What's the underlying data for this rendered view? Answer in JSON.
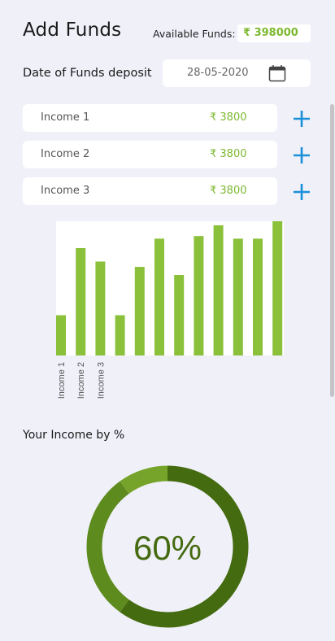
{
  "header": {
    "title": "Add Funds",
    "available_label": "Available Funds:",
    "available_value": "₹ 398000"
  },
  "deposit": {
    "label": "Date of Funds deposit",
    "date_value": "28-05-2020",
    "calendar_icon": "calendar-icon"
  },
  "incomes": [
    {
      "name": "Income 1",
      "amount": "₹ 3800"
    },
    {
      "name": "Income 2",
      "amount": "₹ 3800"
    },
    {
      "name": "Income 3",
      "amount": "₹ 3800"
    }
  ],
  "add_icon": "plus-icon",
  "colors": {
    "accent_green": "#7cb82f",
    "bar_green": "#8ac03a",
    "plus_blue": "#1a8fd8",
    "donut_dark": "#456b10",
    "donut_mid": "#5e8b1e",
    "donut_light": "#76a42a"
  },
  "chart_data": {
    "type": "bar",
    "categories": [
      "Income 1",
      "Income 2",
      "Income 3",
      "",
      "",
      "",
      "",
      "",
      "",
      "",
      "",
      ""
    ],
    "values": [
      30,
      80,
      70,
      30,
      66,
      87,
      60,
      89,
      97,
      87,
      87,
      100
    ],
    "ylim": [
      0,
      100
    ],
    "grid": false
  },
  "donut": {
    "title": "Your Income by %",
    "center_label": "60%",
    "segments": [
      60,
      30,
      10
    ]
  }
}
